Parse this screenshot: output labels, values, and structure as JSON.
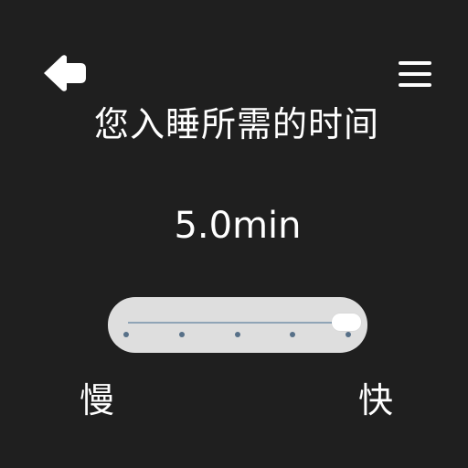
{
  "header": {
    "back_icon": "arrow-left-icon",
    "menu_icon": "hamburger-menu-icon"
  },
  "main": {
    "title": "您入睡所需的时间",
    "value": "5.0min"
  },
  "slider": {
    "steps": 5,
    "selected_step": 5,
    "min_label": "慢",
    "max_label": "快"
  },
  "colors": {
    "background": "#1f1f1f",
    "text": "#ffffff",
    "slider_track_bg": "#dedede",
    "slider_tick": "#577088",
    "slider_line": "#8fa4b6"
  }
}
